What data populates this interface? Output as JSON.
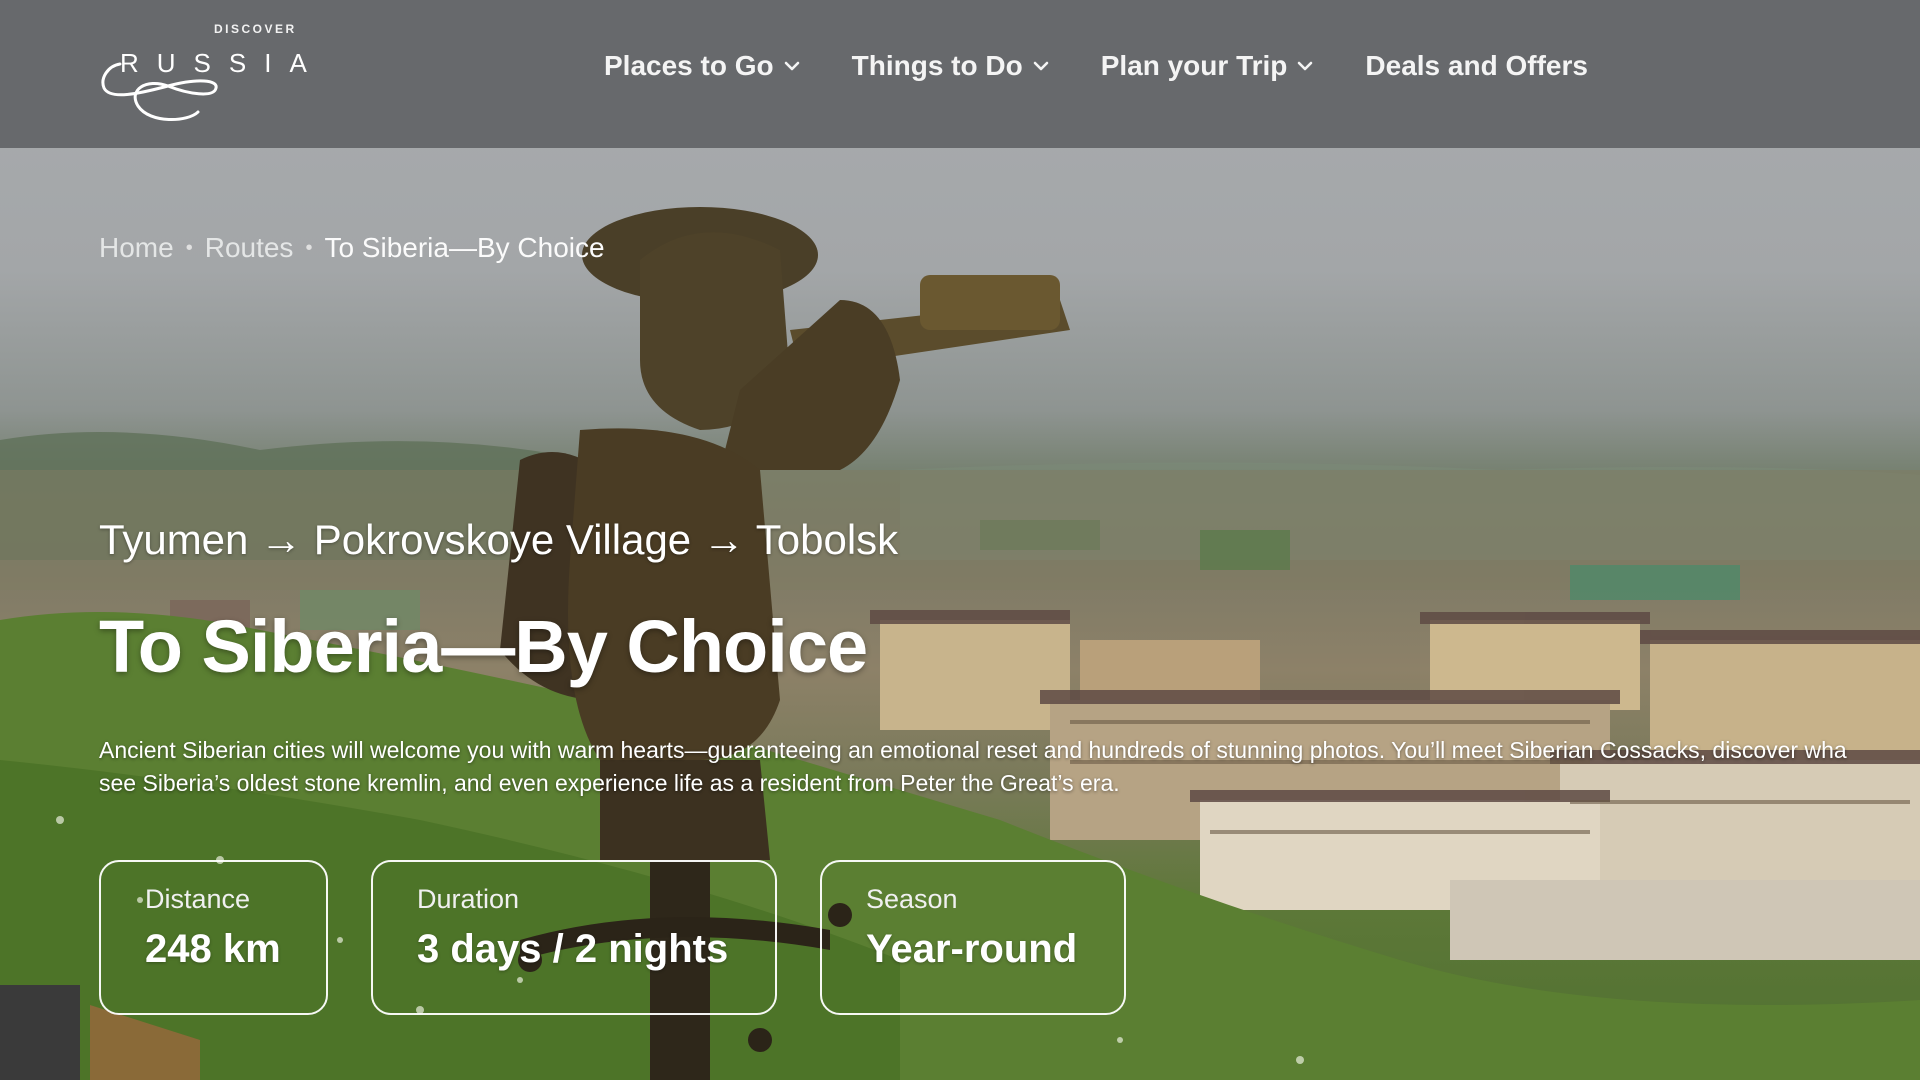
{
  "brand": {
    "small": "DISCOVER",
    "main": "RUSSIA"
  },
  "nav": {
    "items": [
      {
        "label": "Places to Go",
        "dropdown": true
      },
      {
        "label": "Things to Do",
        "dropdown": true
      },
      {
        "label": "Plan your Trip",
        "dropdown": true
      },
      {
        "label": "Deals and Offers",
        "dropdown": false
      }
    ]
  },
  "breadcrumb": {
    "home": "Home",
    "routes": "Routes",
    "current": "To Siberia—By Choice"
  },
  "hero": {
    "route": "Tyumen → Pokrovskoye Village → Tobolsk",
    "title": "To Siberia—By Choice",
    "description_line1": "Ancient Siberian cities will welcome you with warm hearts—guaranteeing an emotional reset and hundreds of stunning photos. You’ll meet Siberian Cossacks, discover wha",
    "description_line2": "see Siberia’s oldest stone kremlin, and even experience life as a resident from Peter the Great’s era."
  },
  "stats": [
    {
      "label": "Distance",
      "value": "248 km"
    },
    {
      "label": "Duration",
      "value": "3 days / 2 nights"
    },
    {
      "label": "Season",
      "value": "Year-round"
    }
  ],
  "colors": {
    "navbar": "#626467",
    "text": "#ffffff",
    "grass": "#4f7030"
  },
  "icons": {
    "dropdown": "chevron-down-icon",
    "logo": "russia-swirl-logo"
  }
}
